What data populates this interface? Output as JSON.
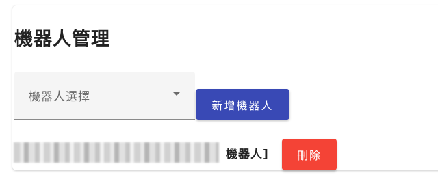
{
  "page": {
    "title": "機器人管理"
  },
  "robot_select": {
    "label": "機器人選擇",
    "icon": "chevron-down-icon"
  },
  "buttons": {
    "add_robot": "新增機器人",
    "delete": "刪除"
  },
  "robot_list": [
    {
      "name_visible": "機器人]"
    }
  ],
  "colors": {
    "add_button_bg": "#3949b5",
    "delete_button_bg": "#f44336",
    "select_bg": "#f5f5f5"
  }
}
